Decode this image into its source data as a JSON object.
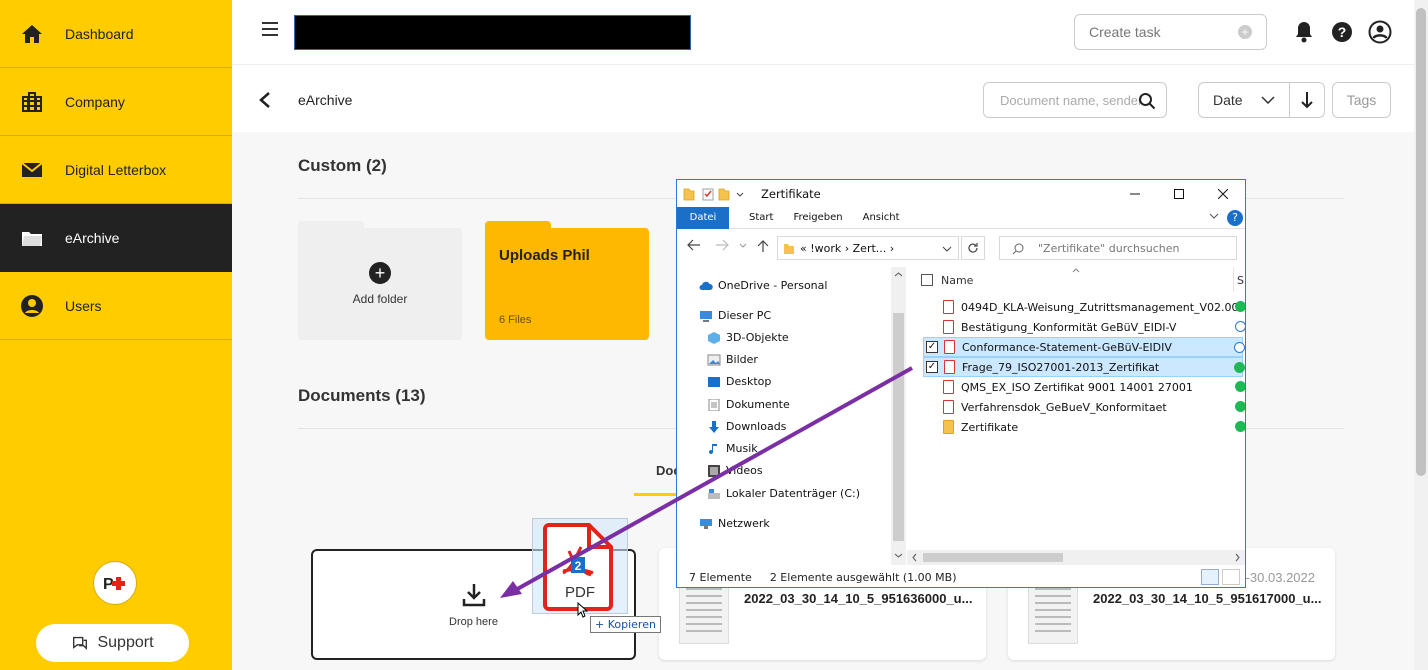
{
  "sidebar": {
    "items": [
      {
        "label": "Dashboard"
      },
      {
        "label": "Company"
      },
      {
        "label": "Digital Letterbox"
      },
      {
        "label": "eArchive"
      },
      {
        "label": "Users"
      }
    ],
    "support_label": "Support"
  },
  "topbar": {
    "create_task_placeholder": "Create task"
  },
  "subheader": {
    "title": "eArchive",
    "search_placeholder": "Document name, sender",
    "sort_selected": "Date",
    "tags_label": "Tags"
  },
  "custom": {
    "title": "Custom (2)",
    "add_folder_label": "Add folder",
    "folders": [
      {
        "name": "Uploads Phil",
        "count": "6 Files"
      }
    ]
  },
  "documents": {
    "title": "Documents (13)",
    "tab_label": "Doc",
    "dropzone_label": "Drop here",
    "cards": [
      {
        "name": "2022_03_30_14_10_5_951636000_u..."
      },
      {
        "name": "2022_03_30_14_10_5_951617000_u...",
        "date": "-30.03.2022"
      }
    ]
  },
  "drag": {
    "badge_count": "2",
    "file_type": "PDF",
    "copy_label": "+ Kopieren"
  },
  "explorer": {
    "title": "Zertifikate",
    "ribbon": {
      "file_tab": "Datei",
      "tabs": [
        "Start",
        "Freigeben",
        "Ansicht"
      ]
    },
    "address": {
      "path": "«  !work  ›  Zert...  ›"
    },
    "search_placeholder": "\"Zertifikate\" durchsuchen",
    "tree": [
      {
        "label": "OneDrive - Personal"
      },
      {
        "label": "Dieser PC"
      },
      {
        "label": "3D-Objekte"
      },
      {
        "label": "Bilder"
      },
      {
        "label": "Desktop"
      },
      {
        "label": "Dokumente"
      },
      {
        "label": "Downloads"
      },
      {
        "label": "Musik"
      },
      {
        "label": "Videos"
      },
      {
        "label": "Lokaler Datenträger (C:)"
      },
      {
        "label": "Netzwerk"
      }
    ],
    "columns": {
      "name": "Name",
      "status": "S"
    },
    "files": [
      {
        "name": "0494D_KLA-Weisung_Zutrittsmanagement_V02.00",
        "selected": false
      },
      {
        "name": "Bestätigung_Konformität GeBüV_EIDI-V",
        "selected": false
      },
      {
        "name": "Conformance-Statement-GeBüV-EIDIV",
        "selected": true
      },
      {
        "name": "Frage_79_ISO27001-2013_Zertifikat",
        "selected": true
      },
      {
        "name": "QMS_EX_ISO Zertifikat 9001 14001 27001",
        "selected": false
      },
      {
        "name": "Verfahrensdok_GeBueV_Konformitaet",
        "selected": false
      },
      {
        "name": "Zertifikate",
        "selected": false
      }
    ],
    "status": {
      "count": "7 Elemente",
      "selection": "2 Elemente ausgewählt (1.00 MB)"
    }
  },
  "colors": {
    "brand_yellow": "#ffcc00",
    "folder_orange": "#ffb800",
    "drag_arrow": "#7b2fa5",
    "explorer_blue": "#1a6fc9"
  }
}
